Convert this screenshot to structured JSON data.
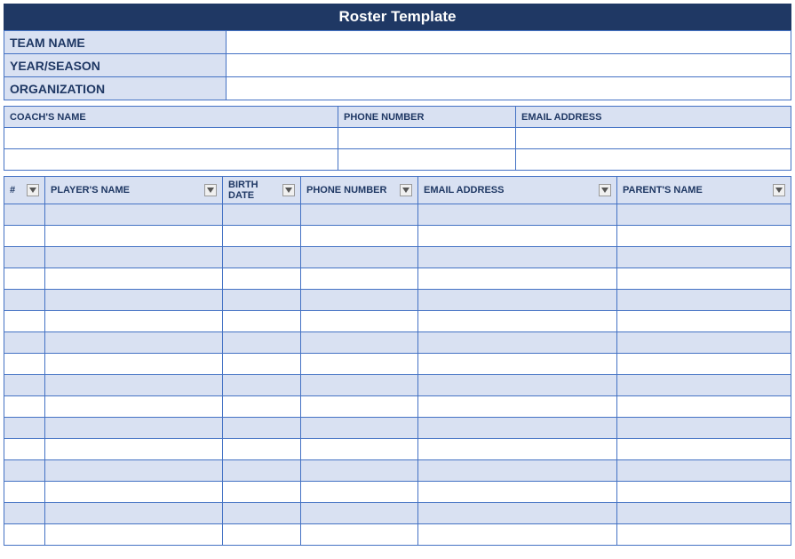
{
  "title": "Roster Template",
  "info": {
    "team_name_label": "TEAM NAME",
    "team_name_value": "",
    "year_season_label": "YEAR/SEASON",
    "year_season_value": "",
    "organization_label": "ORGANIZATION",
    "organization_value": ""
  },
  "coach": {
    "headers": {
      "name": "COACH'S NAME",
      "phone": "PHONE NUMBER",
      "email": "EMAIL ADDRESS"
    },
    "rows": [
      {
        "name": "",
        "phone": "",
        "email": ""
      },
      {
        "name": "",
        "phone": "",
        "email": ""
      }
    ]
  },
  "players": {
    "headers": {
      "number": "#",
      "name": "PLAYER'S NAME",
      "birth": "BIRTH DATE",
      "phone": "PHONE NUMBER",
      "email": "EMAIL ADDRESS",
      "parent": "PARENT'S NAME"
    },
    "rows": [
      {
        "number": "",
        "name": "",
        "birth": "",
        "phone": "",
        "email": "",
        "parent": ""
      },
      {
        "number": "",
        "name": "",
        "birth": "",
        "phone": "",
        "email": "",
        "parent": ""
      },
      {
        "number": "",
        "name": "",
        "birth": "",
        "phone": "",
        "email": "",
        "parent": ""
      },
      {
        "number": "",
        "name": "",
        "birth": "",
        "phone": "",
        "email": "",
        "parent": ""
      },
      {
        "number": "",
        "name": "",
        "birth": "",
        "phone": "",
        "email": "",
        "parent": ""
      },
      {
        "number": "",
        "name": "",
        "birth": "",
        "phone": "",
        "email": "",
        "parent": ""
      },
      {
        "number": "",
        "name": "",
        "birth": "",
        "phone": "",
        "email": "",
        "parent": ""
      },
      {
        "number": "",
        "name": "",
        "birth": "",
        "phone": "",
        "email": "",
        "parent": ""
      },
      {
        "number": "",
        "name": "",
        "birth": "",
        "phone": "",
        "email": "",
        "parent": ""
      },
      {
        "number": "",
        "name": "",
        "birth": "",
        "phone": "",
        "email": "",
        "parent": ""
      },
      {
        "number": "",
        "name": "",
        "birth": "",
        "phone": "",
        "email": "",
        "parent": ""
      },
      {
        "number": "",
        "name": "",
        "birth": "",
        "phone": "",
        "email": "",
        "parent": ""
      },
      {
        "number": "",
        "name": "",
        "birth": "",
        "phone": "",
        "email": "",
        "parent": ""
      },
      {
        "number": "",
        "name": "",
        "birth": "",
        "phone": "",
        "email": "",
        "parent": ""
      },
      {
        "number": "",
        "name": "",
        "birth": "",
        "phone": "",
        "email": "",
        "parent": ""
      },
      {
        "number": "",
        "name": "",
        "birth": "",
        "phone": "",
        "email": "",
        "parent": ""
      }
    ]
  }
}
